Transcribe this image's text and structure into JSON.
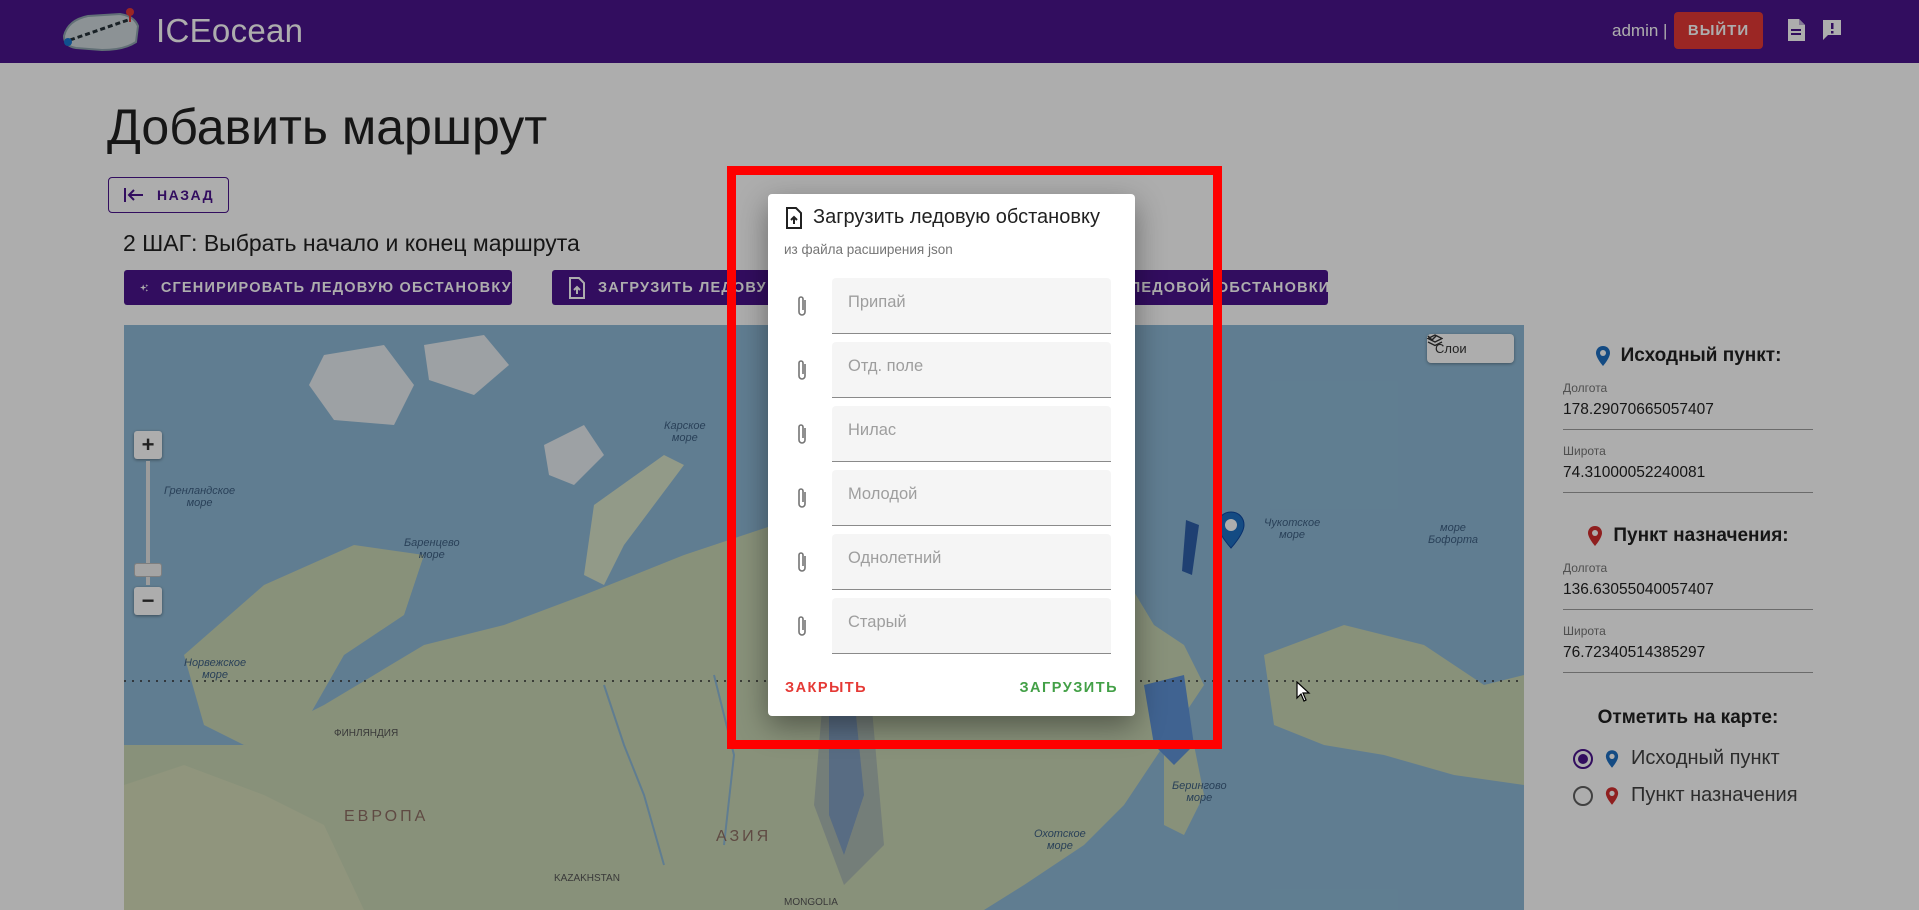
{
  "header": {
    "brand": "ICEocean",
    "user": "admin |",
    "logout_label": "ВЫЙТИ",
    "icons": [
      "document-icon",
      "feedback-icon"
    ]
  },
  "page": {
    "title": "Добавить маршрут",
    "back_label": "НАЗАД",
    "step_text": "2 ШАГ: Выбрать начало и конец маршрута"
  },
  "actions": {
    "generate_label": "СГЕНИРИРОВАТЬ ЛЕДОВУЮ ОБСТАНОВКУ",
    "upload_label": "ЗАГРУЗИТЬ ЛЕДОВУ",
    "third_label": "ЛЕДОВОЙ ОБСТАНОВКИ"
  },
  "map": {
    "layers_label": "Слои",
    "labels": {
      "kara_sea": "Карское\nморе",
      "greenland_sea": "Гренландское\nморе",
      "barents_sea": "Баренцево\nморе",
      "chukchi_sea": "Чукотское\nморе",
      "beaufort_sea": "море\nБофорта",
      "norwegian_sea": "Норвежское\nморе",
      "okhotsk_sea": "Охотское\nморе",
      "bering_sea": "Берингово\nморе",
      "europe": "ЕВРОПА",
      "asia": "АЗИЯ",
      "finland": "ФИНЛЯНДИЯ",
      "kazakhstan": "KAZAKHSTAN",
      "mongolia": "MONGOLIA"
    },
    "colors": {
      "water": "#8eb9d6",
      "land": "#c9d6b4",
      "ice": "#5f93d6",
      "start_pin": "#1e6fc2",
      "dest_pin": "#d32f2f"
    }
  },
  "panel": {
    "origin_heading": "Исходный пункт:",
    "origin_lon_label": "Долгота",
    "origin_lon": "178.29070665057407",
    "origin_lat_label": "Широта",
    "origin_lat": "74.31000052240081",
    "dest_heading": "Пункт назначения:",
    "dest_lon_label": "Долгота",
    "dest_lon": "136.63055040057407",
    "dest_lat_label": "Широта",
    "dest_lat": "76.72340514385297",
    "mark_title": "Отметить на карте:",
    "mark_options": [
      "Исходный пункт",
      "Пункт назначения"
    ],
    "selected_option": "Исходный пункт"
  },
  "dialog": {
    "title": "Загрузить ледовую обстановку",
    "subtitle": "из файла расширения json",
    "files": [
      {
        "placeholder": "Припай"
      },
      {
        "placeholder": "Отд. поле"
      },
      {
        "placeholder": "Нилас"
      },
      {
        "placeholder": "Молодой"
      },
      {
        "placeholder": "Однолетний"
      },
      {
        "placeholder": "Старый"
      }
    ],
    "close_label": "ЗАКРЫТЬ",
    "upload_label": "ЗАГРУЗИТЬ",
    "close_color": "#e53935",
    "upload_color": "#43a047"
  }
}
